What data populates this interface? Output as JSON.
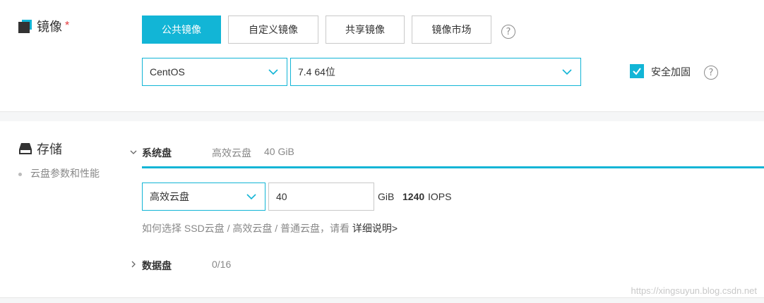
{
  "image_section": {
    "title": "镜像",
    "required_mark": "*",
    "tabs": [
      {
        "label": "公共镜像",
        "active": true
      },
      {
        "label": "自定义镜像",
        "active": false
      },
      {
        "label": "共享镜像",
        "active": false
      },
      {
        "label": "镜像市场",
        "active": false
      }
    ],
    "help": "?",
    "os_select": {
      "value": "CentOS"
    },
    "version_select": {
      "value": "7.4 64位"
    },
    "security": {
      "label": "安全加固",
      "checked": true
    }
  },
  "storage_section": {
    "title": "存储",
    "side_link": "云盘参数和性能",
    "system_disk": {
      "label": "系统盘",
      "summary_type": "高效云盘",
      "summary_size": "40 GiB",
      "type_select": "高效云盘",
      "size_value": "40",
      "unit": "GiB",
      "iops_value": "1240",
      "iops_unit": "IOPS",
      "hint_prefix": "如何选择 SSD云盘 / 高效云盘 / 普通云盘，请看",
      "hint_link": "详细说明>"
    },
    "data_disk": {
      "label": "数据盘",
      "count": "0/16"
    }
  },
  "watermark": "https://xingsuyun.blog.csdn.net",
  "colors": {
    "accent": "#12b5d6",
    "border": "#c9c9c9",
    "required": "#e4393c"
  }
}
